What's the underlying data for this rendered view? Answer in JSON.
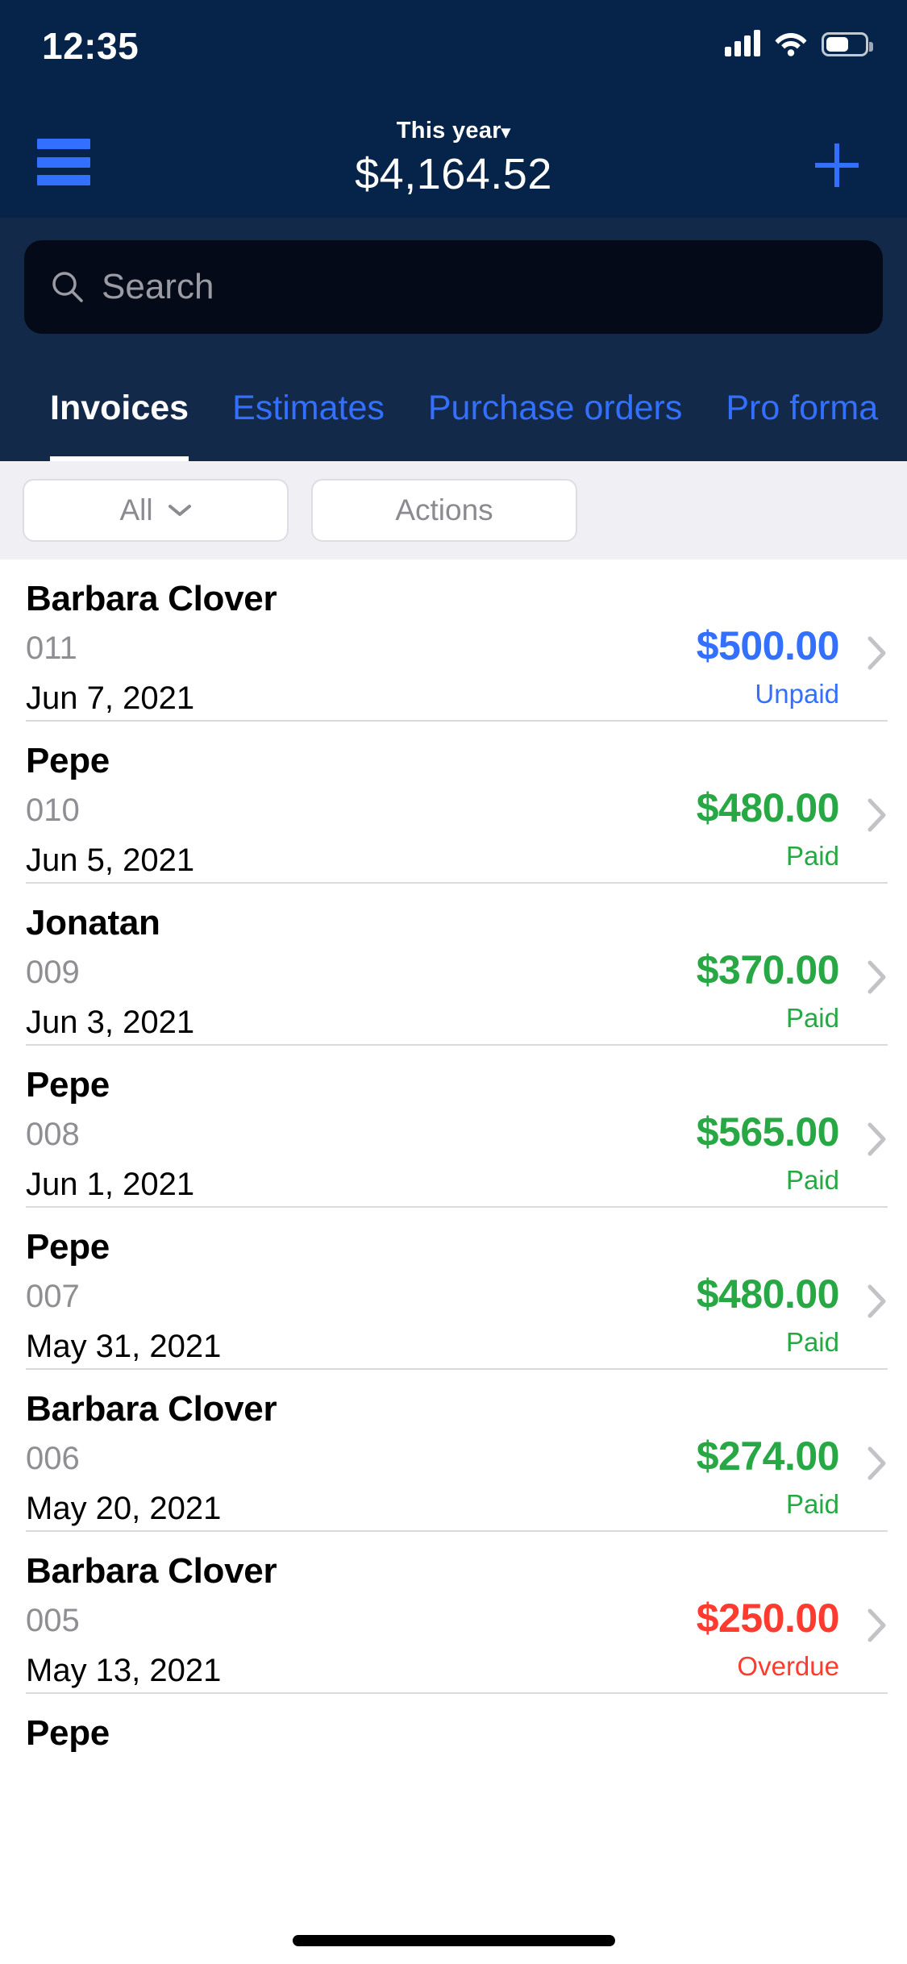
{
  "status_bar": {
    "time": "12:35",
    "signal_icon": "cellular-signal-icon",
    "wifi_icon": "wifi-icon",
    "battery_icon": "battery-icon"
  },
  "header": {
    "menu_icon": "hamburger-menu-icon",
    "period_label": "This year",
    "period_caret": "▾",
    "total_amount": "$4,164.52",
    "add_icon": "plus-icon",
    "background_color": "#062449",
    "accent_color": "#3370ff"
  },
  "search": {
    "placeholder": "Search",
    "value": "",
    "icon": "search-icon"
  },
  "tabs": [
    {
      "label": "Invoices",
      "active": true
    },
    {
      "label": "Estimates",
      "active": false
    },
    {
      "label": "Purchase orders",
      "active": false
    },
    {
      "label": "Pro forma",
      "active": false
    }
  ],
  "filters": {
    "status_filter_label": "All",
    "status_filter_icon": "chevron-down-icon",
    "actions_label": "Actions"
  },
  "colors": {
    "paid": "#28a745",
    "unpaid": "#3370ff",
    "overdue": "#ff3b30",
    "muted": "#8e8e93"
  },
  "invoices": [
    {
      "client": "Barbara Clover",
      "number": "011",
      "date": "Jun 7, 2021",
      "amount": "$500.00",
      "status": "Unpaid",
      "state": "unpaid"
    },
    {
      "client": "Pepe",
      "number": "010",
      "date": "Jun 5, 2021",
      "amount": "$480.00",
      "status": "Paid",
      "state": "paid"
    },
    {
      "client": "Jonatan",
      "number": "009",
      "date": "Jun 3, 2021",
      "amount": "$370.00",
      "status": "Paid",
      "state": "paid"
    },
    {
      "client": "Pepe",
      "number": "008",
      "date": "Jun 1, 2021",
      "amount": "$565.00",
      "status": "Paid",
      "state": "paid"
    },
    {
      "client": "Pepe",
      "number": "007",
      "date": "May 31, 2021",
      "amount": "$480.00",
      "status": "Paid",
      "state": "paid"
    },
    {
      "client": "Barbara Clover",
      "number": "006",
      "date": "May 20, 2021",
      "amount": "$274.00",
      "status": "Paid",
      "state": "paid"
    },
    {
      "client": "Barbara Clover",
      "number": "005",
      "date": "May 13, 2021",
      "amount": "$250.00",
      "status": "Overdue",
      "state": "overdue"
    },
    {
      "client": "Pepe",
      "number": "",
      "date": "",
      "amount": "",
      "status": "",
      "state": "paid"
    }
  ]
}
